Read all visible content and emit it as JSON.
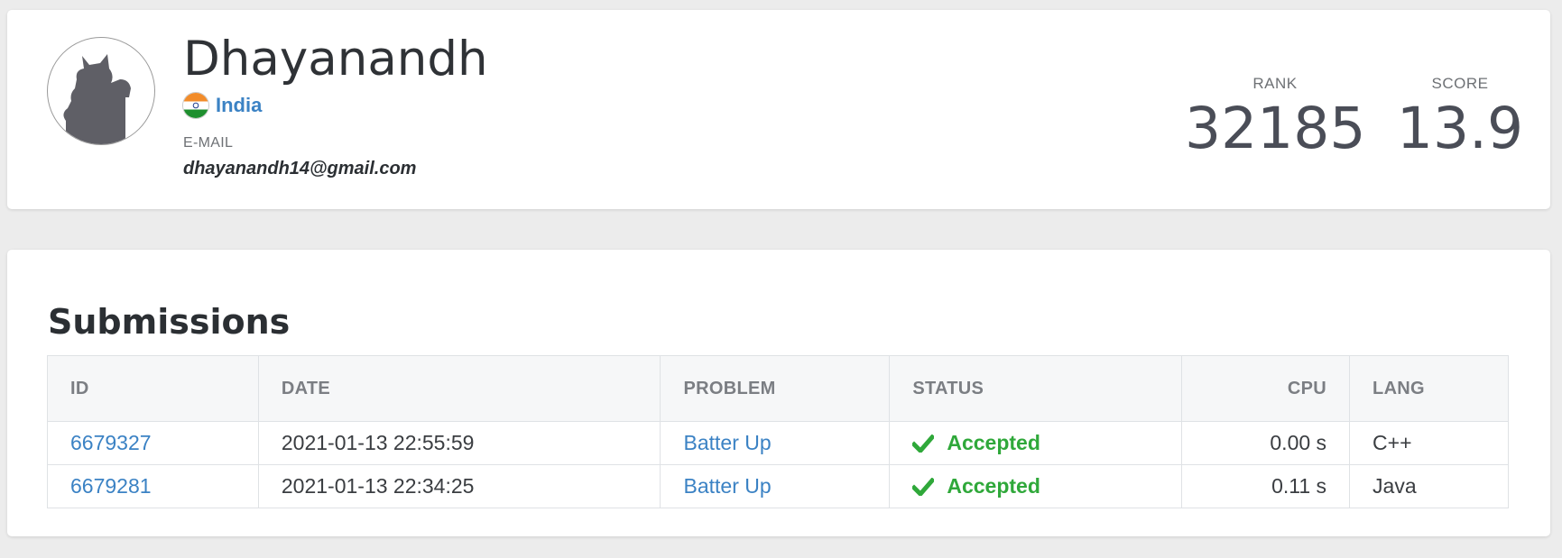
{
  "profile": {
    "name": "Dhayanandh",
    "country": "India",
    "email_label": "E-MAIL",
    "email": "dhayanandh14@gmail.com",
    "avatar_icon": "cat-silhouette-avatar",
    "flag_icon": "india-flag-icon",
    "flag_colors": {
      "saffron": "#f28c2a",
      "white": "#ffffff",
      "green": "#1e8f2e",
      "chakra": "#1f3d8c"
    }
  },
  "stats": {
    "rank_label": "RANK",
    "rank_value": "32185",
    "score_label": "SCORE",
    "score_value": "13.9"
  },
  "submissions": {
    "title": "Submissions",
    "columns": {
      "id": "ID",
      "date": "DATE",
      "problem": "PROBLEM",
      "status": "STATUS",
      "cpu": "CPU",
      "lang": "LANG"
    },
    "rows": [
      {
        "id": "6679327",
        "date": "2021-01-13 22:55:59",
        "problem": "Batter Up",
        "status": "Accepted",
        "cpu": "0.00 s",
        "lang": "C++"
      },
      {
        "id": "6679281",
        "date": "2021-01-13 22:34:25",
        "problem": "Batter Up",
        "status": "Accepted",
        "cpu": "0.11 s",
        "lang": "Java"
      }
    ]
  },
  "colors": {
    "link": "#3b82c4",
    "accepted": "#2fa83a",
    "stat_value": "#4a4d57"
  }
}
